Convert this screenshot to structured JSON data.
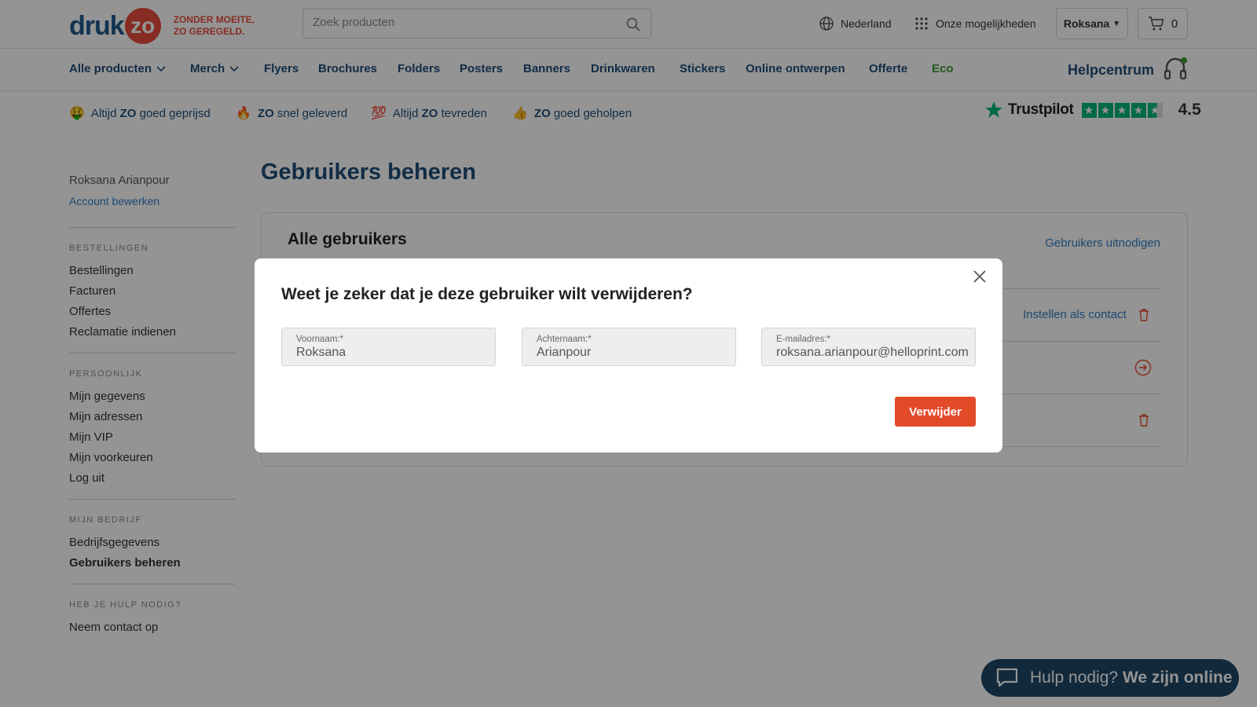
{
  "header": {
    "logo_word": "druk",
    "logo_circle": "zo",
    "tagline_line1": "ZONDER MOEITE,",
    "tagline_line2": "ZO GEREGELD.",
    "search_placeholder": "Zoek producten",
    "country": "Nederland",
    "options": "Onze mogelijkheden",
    "user": "Roksana",
    "cart_count": "0"
  },
  "nav": {
    "items": [
      "Alle producten",
      "Merch",
      "Flyers",
      "Brochures",
      "Folders",
      "Posters",
      "Banners",
      "Drinkwaren",
      "Stickers",
      "Online ontwerpen",
      "Offerte",
      "Eco"
    ],
    "helpcentrum": "Helpcentrum"
  },
  "usps": [
    {
      "emoji": "🤑",
      "pre": "Altijd ",
      "bold": "ZO",
      "post": " goed geprijsd"
    },
    {
      "emoji": "🔥",
      "pre": "",
      "bold": "ZO",
      "post": " snel geleverd"
    },
    {
      "emoji": "💯",
      "pre": "Altijd ",
      "bold": "ZO",
      "post": " tevreden"
    },
    {
      "emoji": "👍",
      "pre": "",
      "bold": "ZO",
      "post": " goed geholpen"
    }
  ],
  "trustpilot": {
    "name": "Trustpilot",
    "score": "4.5",
    "rating": 4.5
  },
  "sidebar": {
    "user_name": "Roksana Arianpour",
    "edit_account": "Account bewerken",
    "sections": [
      {
        "heading": "BESTELLINGEN",
        "items": [
          "Bestellingen",
          "Facturen",
          "Offertes",
          "Reclamatie indienen"
        ]
      },
      {
        "heading": "PERSOONLIJK",
        "items": [
          "Mijn gegevens",
          "Mijn adressen",
          "Mijn VIP",
          "Mijn voorkeuren",
          "Log uit"
        ]
      },
      {
        "heading": "MIJN BEDRIJF",
        "items": [
          "Bedrijfsgegevens",
          "Gebruikers beheren"
        ]
      },
      {
        "heading": "HEB JE HULP NODIG?",
        "items": [
          "Neem contact op"
        ]
      }
    ]
  },
  "main": {
    "page_title": "Gebruikers beheren",
    "card_title": "Alle gebruikers",
    "invite_link": "Gebruikers uitnodigen",
    "set_contact": "Instellen als contact"
  },
  "modal": {
    "title": "Weet je zeker dat je deze gebruiker wilt verwijderen?",
    "fields": [
      {
        "label": "Voornaam:*",
        "value": "Roksana"
      },
      {
        "label": "Achternaam:*",
        "value": "Arianpour"
      },
      {
        "label": "E-mailadres:*",
        "value": "roksana.arianpour@helloprint.com"
      }
    ],
    "delete_label": "Verwijder"
  },
  "chat": {
    "pre": "Hulp nodig?",
    "bold": "We zijn online"
  },
  "colors": {
    "brand_blue": "#1f4e79",
    "brand_red": "#e74c3c",
    "delete_red": "#e34a2a",
    "eco_green": "#3c9c35",
    "link_blue": "#2f7dc1",
    "chat_bg": "#1f4766",
    "trustpilot_green": "#00b67a"
  }
}
